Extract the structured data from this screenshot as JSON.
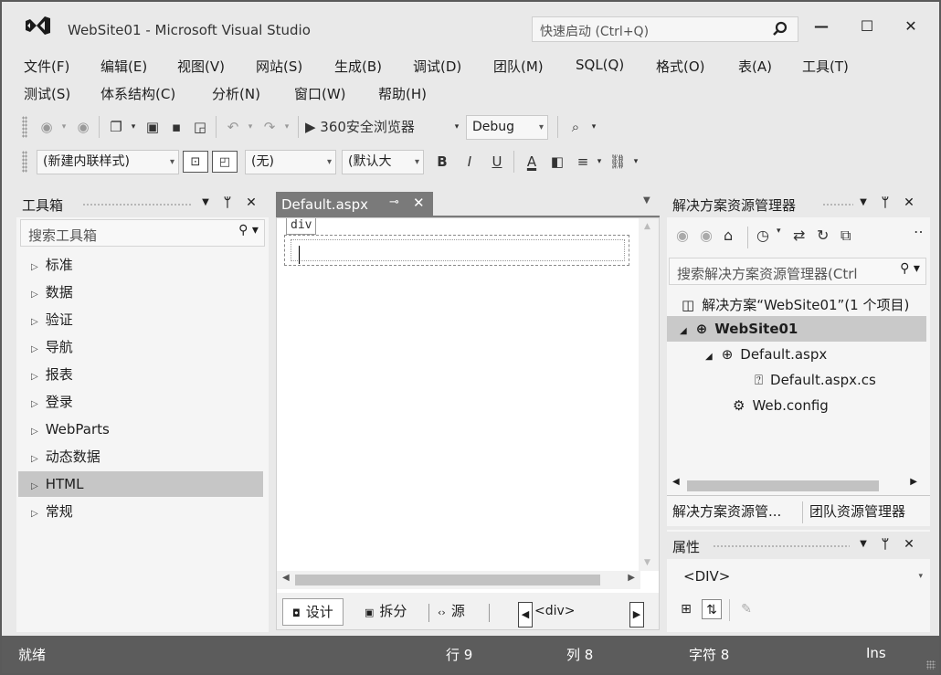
{
  "window": {
    "title": "WebSite01 - Microsoft Visual Studio",
    "quick_launch_placeholder": "快速启动 (Ctrl+Q)",
    "minimize": "—",
    "maximize": "☐",
    "close": "✕"
  },
  "menu": {
    "row1": [
      "文件(F)",
      "编辑(E)",
      "视图(V)",
      "网站(S)",
      "生成(B)",
      "调试(D)",
      "团队(M)",
      "SQL(Q)",
      "格式(O)",
      "表(A)",
      "工具(T)"
    ],
    "row2": [
      "测试(S)",
      "体系结构(C)",
      "分析(N)",
      "窗口(W)",
      "帮助(H)"
    ]
  },
  "toolbar1": {
    "run_label": "▶ 360安全浏览器",
    "config_value": "Debug"
  },
  "toolbar2": {
    "style_target": "(新建内联样式)",
    "block_format": "(无)",
    "font_name": "(默认大",
    "bold": "B",
    "italic": "I",
    "underline": "U",
    "font_color": "A"
  },
  "toolbox": {
    "title": "工具箱",
    "search_placeholder": "搜索工具箱",
    "items": [
      {
        "label": "标准",
        "selected": false
      },
      {
        "label": "数据",
        "selected": false
      },
      {
        "label": "验证",
        "selected": false
      },
      {
        "label": "导航",
        "selected": false
      },
      {
        "label": "报表",
        "selected": false
      },
      {
        "label": "登录",
        "selected": false
      },
      {
        "label": "WebParts",
        "selected": false
      },
      {
        "label": "动态数据",
        "selected": false
      },
      {
        "label": "HTML",
        "selected": true
      },
      {
        "label": "常规",
        "selected": false
      }
    ]
  },
  "editor": {
    "tab_label": "Default.aspx",
    "tag_label": "div",
    "views": {
      "design": "设计",
      "split": "拆分",
      "source": "源"
    },
    "tag_path": "<div>"
  },
  "solution_explorer": {
    "title": "解决方案资源管理器",
    "search_placeholder": "搜索解决方案资源管理器(Ctrl",
    "tree": [
      {
        "label": "解决方案“WebSite01”(1 个项目)",
        "icon": "solution-icon"
      },
      {
        "label": "WebSite01",
        "icon": "website-icon",
        "bold": true,
        "selected": true
      },
      {
        "label": "Default.aspx",
        "icon": "aspx-file-icon"
      },
      {
        "label": "Default.aspx.cs",
        "icon": "cs-file-icon"
      },
      {
        "label": "Web.config",
        "icon": "config-file-icon"
      }
    ],
    "tabs": [
      "解决方案资源管...",
      "团队资源管理器"
    ]
  },
  "properties": {
    "title": "属性",
    "selected_object": "<DIV>"
  },
  "statusbar": {
    "status": "就绪",
    "line": "行 9",
    "col": "列 8",
    "char": "字符 8",
    "mode": "Ins"
  },
  "colors": {
    "chrome": "#e9e9e9",
    "statusbar": "#5c5c5c",
    "active_tab": "#7a7a7a",
    "selection": "#c9c9c9"
  }
}
